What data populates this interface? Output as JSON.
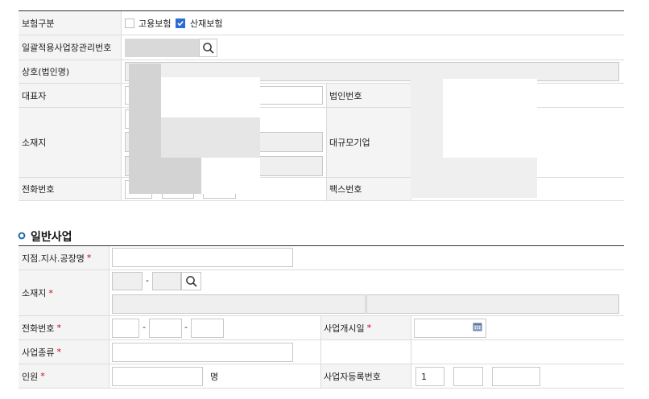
{
  "employer": {
    "insurance_type_label": "보험구분",
    "insurance_options": [
      {
        "label": "고용보험",
        "checked": false
      },
      {
        "label": "산재보험",
        "checked": true
      }
    ],
    "mgmt_number_label": "일괄적용사업장관리번호",
    "company_name_label": "상호(법인명)",
    "ceo_label": "대표자",
    "corp_number_label": "법인번호",
    "address_label": "소재지",
    "large_company_label": "대규모기업",
    "phone_label": "전화번호",
    "fax_label": "팩스번호"
  },
  "general": {
    "section_title": "일반사업",
    "branch_label": "지점.지사.공장명",
    "address_label": "소재지",
    "zip_separator": "-",
    "phone_label": "전화번호",
    "phone_separator": "-",
    "start_date_label": "사업개시일",
    "business_type_label": "사업종류",
    "staff_label": "인원",
    "staff_unit": "명",
    "biz_reg_label": "사업자등록번호",
    "biz_reg_value": "1",
    "required_mark": "*"
  },
  "colors": {
    "required": "#d0021b",
    "checkbox_checked": "#2b6cd4",
    "section_bullet": "#1f6fa3"
  }
}
